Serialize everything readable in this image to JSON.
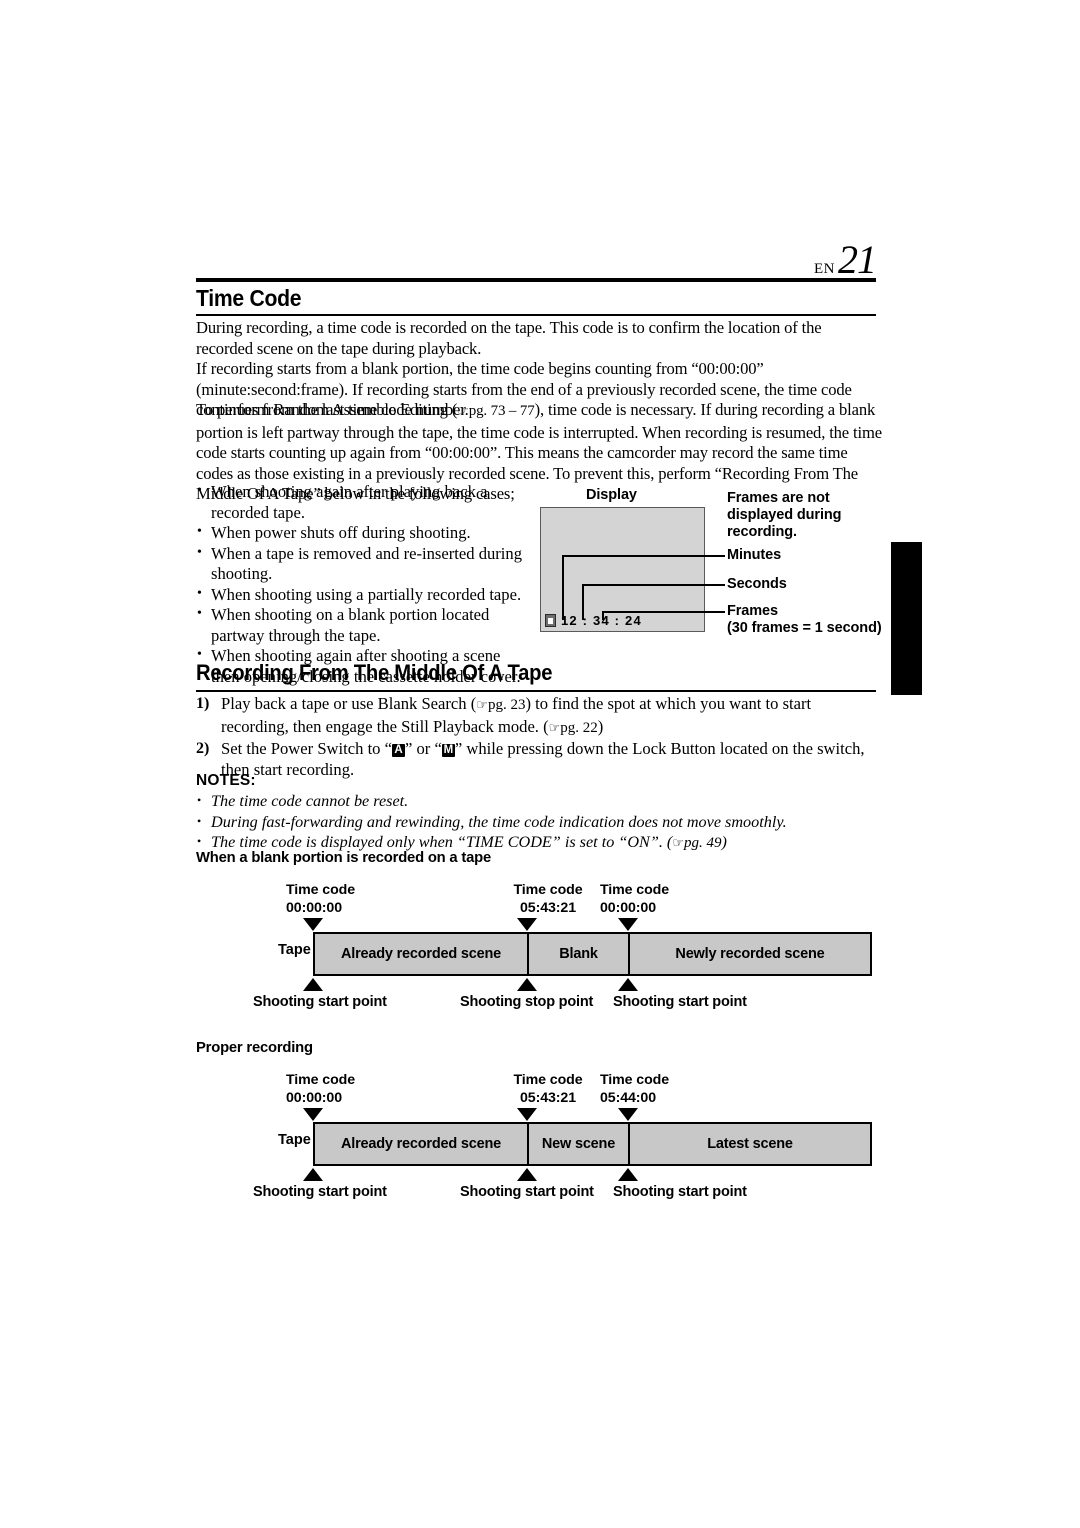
{
  "header": {
    "lang": "EN",
    "page_number": "21"
  },
  "section1": {
    "title": "Time Code",
    "paragraphs": [
      "During recording, a time code is recorded on the tape. This code is to confirm the location of the recorded scene on the tape during playback.",
      "If recording starts from a blank portion, the time code begins counting from “00:00:00” (minute:second:frame). If recording starts from the end of a previously recorded scene, the time code continues from the last time code number."
    ],
    "paragraph3_pre": "To perform Random Assemble Editing (",
    "paragraph3_ref": "pg. 73 – 77",
    "paragraph3_post": "), time code is necessary. If during recording a blank portion is left partway through the tape, the time code is interrupted. When recording is resumed, the time code starts counting up again from “00:00:00”. This means the camcorder may record the same time codes as those existing in a previously recorded scene. To prevent this, perform “Recording From The Middle Of A Tape” below in the following cases;",
    "bullets": [
      "When shooting again after playing back a recorded tape.",
      "When power shuts off during shooting.",
      "When a tape is removed and re-inserted during shooting.",
      "When shooting using a partially recorded tape.",
      "When shooting on a blank portion located partway through the tape.",
      "When shooting again after shooting a scene then opening/closing the cassette holder cover."
    ]
  },
  "display_figure": {
    "caption": "Display",
    "timecode": "12 : 34 : 24",
    "badge_icon": "cassette-tape-icon",
    "callouts": [
      "Frames are not displayed during recording.",
      "Minutes",
      "Seconds",
      "Frames\n(30 frames = 1 second)"
    ],
    "callout_frames_line1": "Frames",
    "callout_frames_line2": "(30 frames = 1 second)"
  },
  "section2": {
    "title": "Recording From The Middle Of A Tape",
    "step1_num": "1)",
    "step1_pre": "Play back a tape or use Blank Search (",
    "step1_ref1": "pg. 23",
    "step1_mid": ") to find the spot at which you want to start recording, then engage the Still Playback mode. (",
    "step1_ref2": "pg. 22",
    "step1_post": ")",
    "step2_num": "2)",
    "step2_pre": "Set the Power Switch to “",
    "step2_key_a": "A",
    "step2_mid": "” or “",
    "step2_key_m": "M",
    "step2_post": "” while pressing down the Lock Button located on the switch, then start recording."
  },
  "notes": {
    "title": "NOTES:",
    "items": [
      "The time code cannot be reset.",
      "During fast-forwarding and rewinding, the time code indication does not move smoothly."
    ],
    "item3_pre": "The time code is displayed only when “TIME CODE” is set to “ON”. (",
    "item3_ref": "pg. 49",
    "item3_post": ")"
  },
  "diagram1": {
    "title": "When a blank portion is recorded on a tape",
    "tape_word": "Tape",
    "timecode_label": "Time code",
    "timecodes": [
      "00:00:00",
      "05:43:21",
      "00:00:00"
    ],
    "segments": [
      "Already recorded scene",
      "Blank",
      "Newly recorded scene"
    ],
    "points": [
      "Shooting start point",
      "Shooting stop point",
      "Shooting start point"
    ]
  },
  "diagram2": {
    "title": "Proper recording",
    "tape_word": "Tape",
    "timecode_label": "Time code",
    "timecodes": [
      "00:00:00",
      "05:43:21",
      "05:44:00"
    ],
    "segments": [
      "Already recorded scene",
      "New scene",
      "Latest scene"
    ],
    "points": [
      "Shooting start point",
      "Shooting start point",
      "Shooting start point"
    ]
  },
  "edge_tab": {
    "name": "chapter-edge-marker",
    "color": "#000000"
  }
}
